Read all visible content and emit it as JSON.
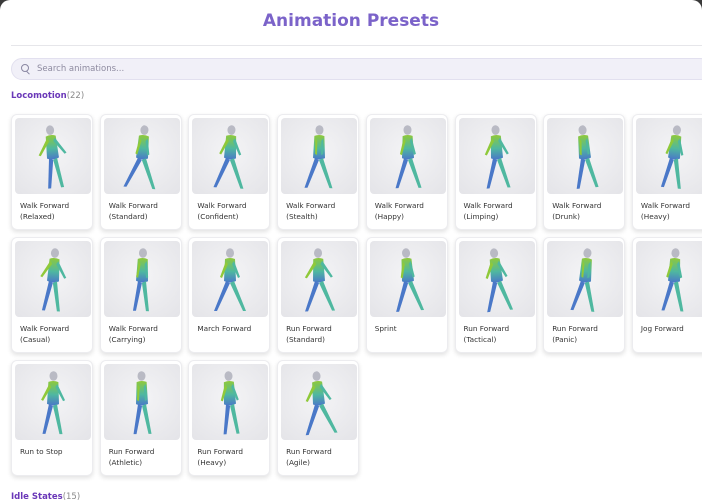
{
  "header": {
    "title": "Animation Presets"
  },
  "search": {
    "placeholder": "Search animations..."
  },
  "sections": [
    {
      "name": "Locomotion",
      "count": "(22)",
      "items": [
        {
          "line1": "Walk Forward",
          "line2": "(Relaxed)"
        },
        {
          "line1": "Walk Forward",
          "line2": "(Standard)"
        },
        {
          "line1": "Walk Forward",
          "line2": "(Confident)"
        },
        {
          "line1": "Walk Forward",
          "line2": "(Stealth)"
        },
        {
          "line1": "Walk Forward",
          "line2": "(Happy)"
        },
        {
          "line1": "Walk Forward",
          "line2": "(Limping)"
        },
        {
          "line1": "Walk Forward",
          "line2": "(Drunk)"
        },
        {
          "line1": "Walk Forward",
          "line2": "(Heavy)"
        },
        {
          "line1": "Walk Forward",
          "line2": "(Casual)"
        },
        {
          "line1": "Walk Forward",
          "line2": "(Carrying)"
        },
        {
          "line1": "March Forward",
          "line2": ""
        },
        {
          "line1": "Run Forward",
          "line2": "(Standard)"
        },
        {
          "line1": "Sprint",
          "line2": ""
        },
        {
          "line1": "Run Forward",
          "line2": "(Tactical)"
        },
        {
          "line1": "Run Forward",
          "line2": "(Panic)"
        },
        {
          "line1": "Jog Forward",
          "line2": ""
        },
        {
          "line1": "Run to Stop",
          "line2": ""
        },
        {
          "line1": "Run Forward",
          "line2": "(Athletic)"
        },
        {
          "line1": "Run Forward",
          "line2": "(Heavy)"
        },
        {
          "line1": "Run Forward",
          "line2": "(Agile)"
        }
      ]
    },
    {
      "name": "Idle States",
      "count": "(15)"
    }
  ],
  "colors": {
    "accent": "#7b63c9",
    "section": "#6a38b8",
    "figure_top": "#8fc93a",
    "figure_mid": "#4fb8a0",
    "figure_bottom": "#4a78c8"
  }
}
